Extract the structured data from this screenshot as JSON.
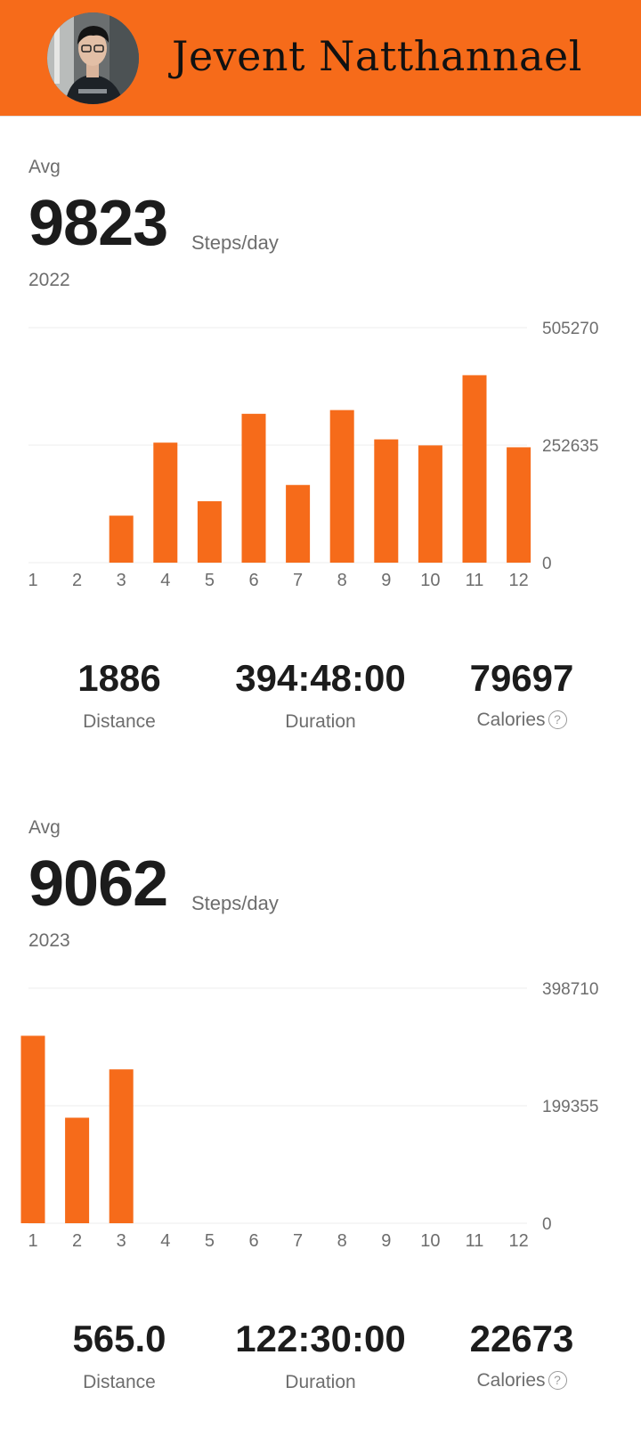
{
  "header": {
    "user_name": "Jevent Natthannael",
    "accent": "#f66b1a"
  },
  "sections": [
    {
      "avg_label": "Avg",
      "avg_value": "9823",
      "avg_unit": "Steps/day",
      "year": "2022",
      "stats": [
        {
          "value": "1886",
          "label": "Distance"
        },
        {
          "value": "394:48:00",
          "label": "Duration"
        },
        {
          "value": "79697",
          "label": "Calories"
        }
      ]
    },
    {
      "avg_label": "Avg",
      "avg_value": "9062",
      "avg_unit": "Steps/day",
      "year": "2023",
      "stats": [
        {
          "value": "565.0",
          "label": "Distance"
        },
        {
          "value": "122:30:00",
          "label": "Duration"
        },
        {
          "value": "22673",
          "label": "Calories"
        }
      ]
    }
  ],
  "chart_data": [
    {
      "type": "bar",
      "categories": [
        "1",
        "2",
        "3",
        "4",
        "5",
        "6",
        "7",
        "8",
        "9",
        "10",
        "11",
        "12"
      ],
      "values": [
        0,
        0,
        101000,
        258000,
        132000,
        320000,
        167000,
        328000,
        265000,
        252000,
        403000,
        248000
      ],
      "y_ticks": [
        "0",
        "252635",
        "505270"
      ],
      "ylim": [
        0,
        505270
      ],
      "color": "#f66b1a",
      "grid": true
    },
    {
      "type": "bar",
      "categories": [
        "1",
        "2",
        "3",
        "4",
        "5",
        "6",
        "7",
        "8",
        "9",
        "10",
        "11",
        "12"
      ],
      "values": [
        318000,
        179000,
        261000,
        0,
        0,
        0,
        0,
        0,
        0,
        0,
        0,
        0
      ],
      "y_ticks": [
        "0",
        "199355",
        "398710"
      ],
      "ylim": [
        0,
        398710
      ],
      "color": "#f66b1a",
      "grid": true
    }
  ]
}
